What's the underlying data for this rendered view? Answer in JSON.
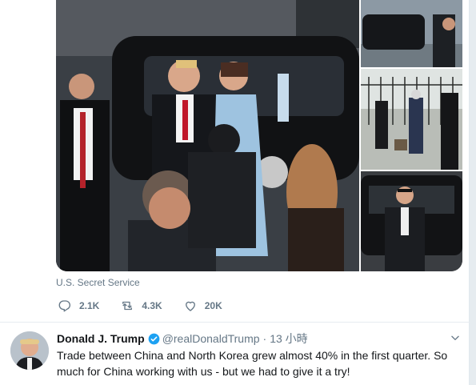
{
  "media": {
    "caption": "U.S. Secret Service",
    "photos": [
      "main-photo",
      "motorcade-photo",
      "agents-with-dog-photo",
      "agent-by-car-photo"
    ]
  },
  "actions": {
    "reply_count": "2.1K",
    "retweet_count": "4.3K",
    "like_count": "20K"
  },
  "tweet": {
    "author_name": "Donald J. Trump",
    "handle": "@realDonaldTrump",
    "separator": "·",
    "time": "13 小時",
    "text": "Trade between China and North Korea grew almost 40% in the first quarter. So much for China working with us - but we had to give it a try!"
  },
  "colors": {
    "muted": "#657786",
    "verified": "#1da1f2",
    "text": "#14171a"
  }
}
